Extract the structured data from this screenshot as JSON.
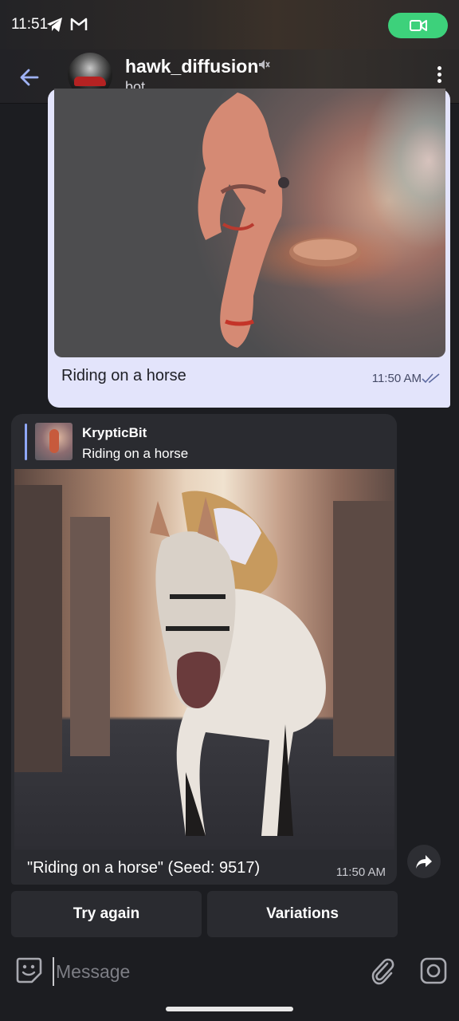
{
  "status_bar": {
    "time": "11:51",
    "call_color": "#3dd17b"
  },
  "header": {
    "title": "hawk_diffusion",
    "subtitle": "bot",
    "icons": [
      "back-arrow-icon",
      "mute-icon",
      "more-vertical-icon"
    ]
  },
  "messages": {
    "outgoing": {
      "text": "Riding on a horse",
      "time": "11:50 AM",
      "status": "read",
      "bubble_color": "#e3e4fb"
    },
    "incoming": {
      "reply_to_name": "KrypticBit",
      "reply_to_text": "Riding on a horse",
      "caption": "\"Riding on a horse\" (Seed: 9517)",
      "time": "11:50 AM",
      "bubble_color": "#2a2b30"
    }
  },
  "keyboard": {
    "buttons": [
      "Try again",
      "Variations"
    ]
  },
  "composer": {
    "placeholder": "Message"
  },
  "accent": "#8fa7f7"
}
